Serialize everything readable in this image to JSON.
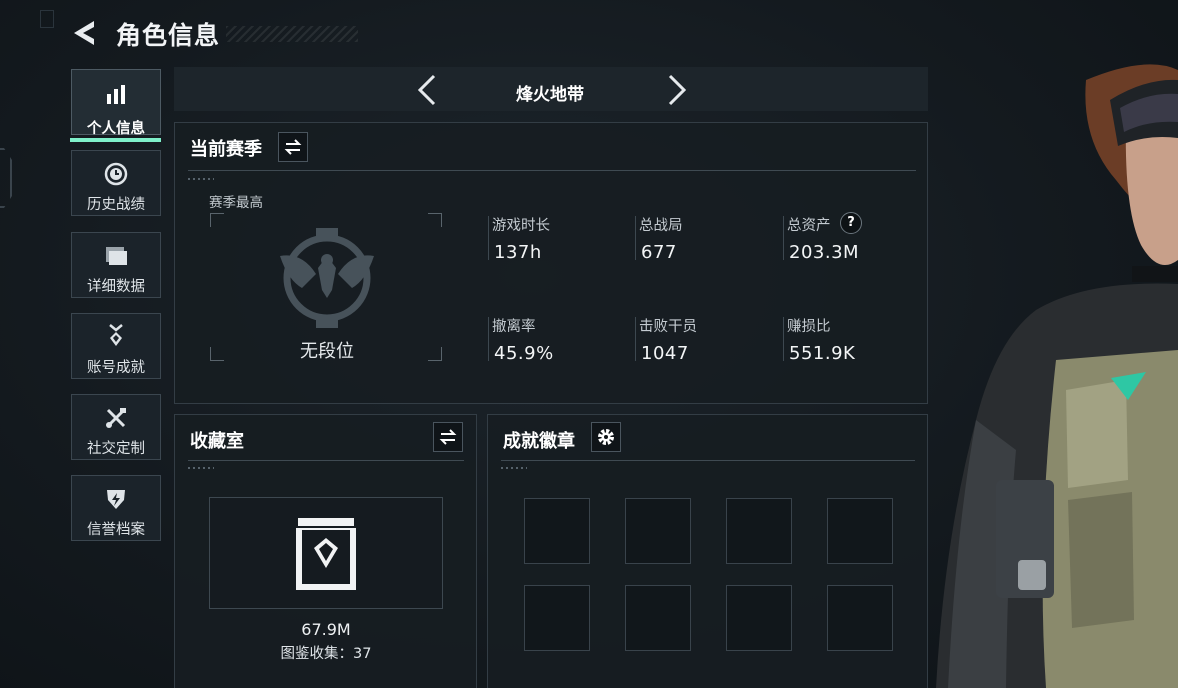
{
  "header": {
    "title": "角色信息",
    "back_icon": "back-arrow-icon"
  },
  "sidebar": {
    "items": [
      {
        "label": "个人信息",
        "icon": "bar-chart-icon",
        "active": true
      },
      {
        "label": "历史战绩",
        "icon": "history-clock-icon",
        "active": false
      },
      {
        "label": "详细数据",
        "icon": "folder-icon",
        "active": false
      },
      {
        "label": "账号成就",
        "icon": "medal-icon",
        "active": false
      },
      {
        "label": "社交定制",
        "icon": "tools-icon",
        "active": false
      },
      {
        "label": "信誉档案",
        "icon": "shield-bolt-icon",
        "active": false
      }
    ],
    "accent_color": "#7ff0ca"
  },
  "mode": {
    "title": "烽火地带"
  },
  "season": {
    "title": "当前赛季",
    "best_label": "赛季最高",
    "rank_text": "无段位",
    "stats": [
      {
        "label": "游戏时长",
        "value": "137h"
      },
      {
        "label": "总战局",
        "value": "677"
      },
      {
        "label": "总资产",
        "value": "203.3M"
      },
      {
        "label": "撤离率",
        "value": "45.9%"
      },
      {
        "label": "击败干员",
        "value": "1047"
      },
      {
        "label": "赚损比",
        "value": "551.9K"
      }
    ],
    "help_label": "?"
  },
  "collection": {
    "title": "收藏室",
    "value": "67.9M",
    "count_label": "图鉴收集：37"
  },
  "badges": {
    "title": "成就徽章",
    "slot_count": 8
  }
}
